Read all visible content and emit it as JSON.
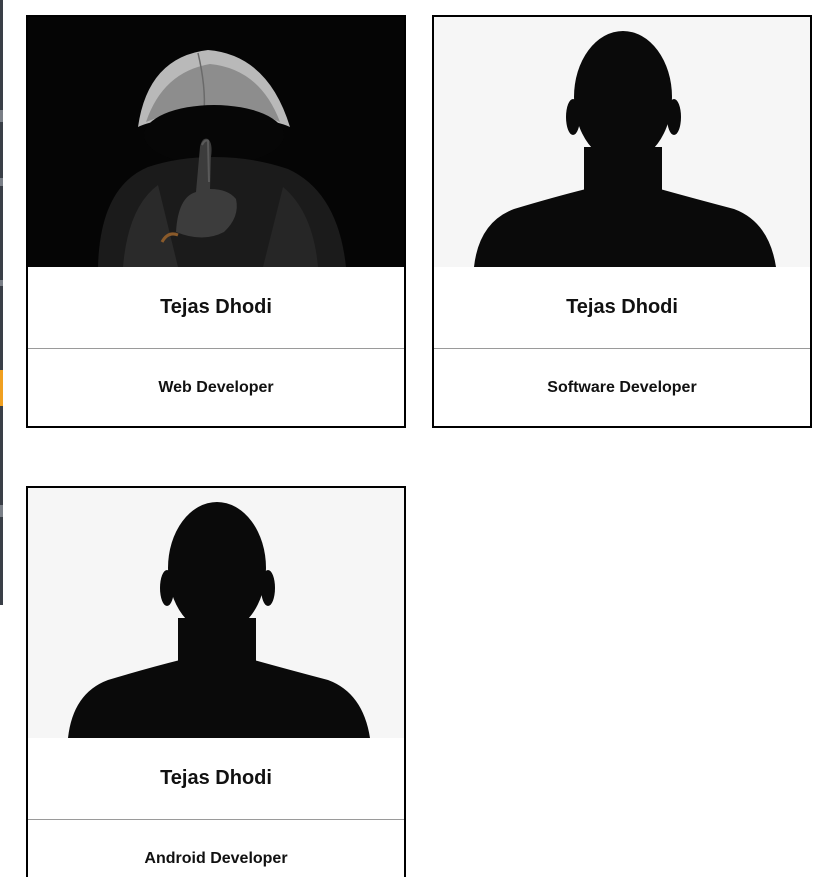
{
  "cards": [
    {
      "name": "Tejas Dhodi",
      "role": "Web Developer",
      "photo_icon": "hooded-figure-photo",
      "photo_style": "dark"
    },
    {
      "name": "Tejas Dhodi",
      "role": "Software Developer",
      "photo_icon": "person-silhouette-photo",
      "photo_style": "light"
    },
    {
      "name": "Tejas Dhodi",
      "role": "Android Developer",
      "photo_icon": "person-silhouette-photo",
      "photo_style": "light"
    }
  ],
  "colors": {
    "card_border": "#000000",
    "divider": "#9a9a9a",
    "dark_photo_bg": "#050505",
    "light_photo_bg": "#f6f6f6",
    "silhouette": "#0a0a0a"
  }
}
